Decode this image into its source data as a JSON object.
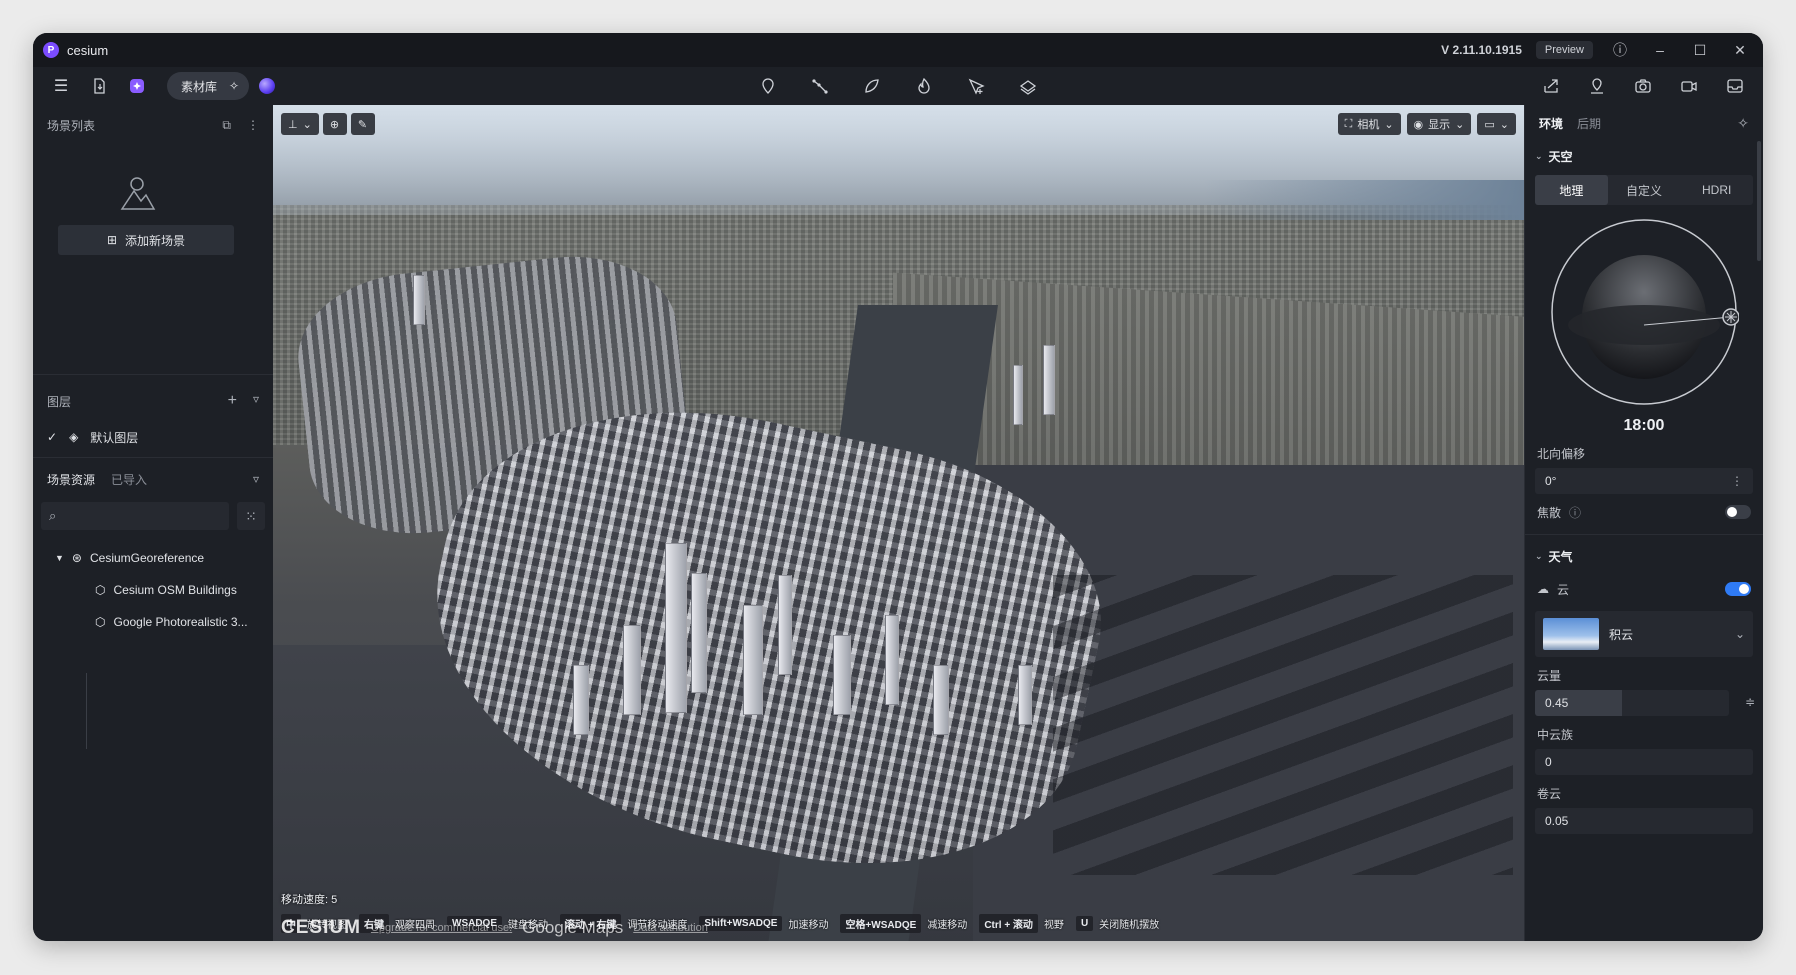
{
  "app": {
    "logo_letter": "P",
    "title": "cesium",
    "version": "V 2.11.10.1915",
    "preview": "Preview"
  },
  "toolbar": {
    "library": "素材库"
  },
  "scene_list": {
    "title": "场景列表",
    "add_scene": "添加新场景"
  },
  "layers": {
    "title": "图层",
    "items": [
      {
        "label": "默认图层",
        "checked": true
      }
    ]
  },
  "assets": {
    "tab_active": "场景资源",
    "tab_inactive": "已导入",
    "search_placeholder": "",
    "tree": [
      {
        "label": "CesiumGeoreference",
        "level": 0,
        "expanded": true
      },
      {
        "label": "Cesium OSM Buildings",
        "level": 1
      },
      {
        "label": "Google Photorealistic 3...",
        "level": 1
      }
    ]
  },
  "viewport": {
    "camera_btn": "相机",
    "display_btn": "显示",
    "speed": "移动速度: 5",
    "shortcuts": [
      {
        "key": "中",
        "desc": "旋转视图"
      },
      {
        "key": "右键",
        "desc": "观察四周"
      },
      {
        "key": "WSADQE",
        "desc": "键盘移动"
      },
      {
        "key": "滚动 + 右键",
        "desc": "调节移动速度"
      },
      {
        "key": "Shift+WSADQE",
        "desc": "加速移动"
      },
      {
        "key": "空格+WSADQE",
        "desc": "减速移动"
      },
      {
        "key": "Ctrl + 滚动",
        "desc": "视野"
      },
      {
        "key": "U",
        "desc": "关闭随机摆放"
      }
    ],
    "attribution": {
      "cesium": "CESIUM",
      "upgrade": "Upgrade for commercial use.",
      "google": "Google Maps",
      "data": "Data attribution"
    }
  },
  "right_panel": {
    "tabs": [
      "环境",
      "后期"
    ],
    "sky": {
      "title": "天空",
      "modes": [
        "地理",
        "自定义",
        "HDRI"
      ],
      "active_mode": "地理",
      "time": "18:00",
      "north_offset_label": "北向偏移",
      "north_offset_value": "0°",
      "focus_label": "焦散",
      "focus_enabled": false
    },
    "weather": {
      "title": "天气",
      "cloud_label": "云",
      "cloud_enabled": true,
      "cloud_type": "积云",
      "cloud_amount_label": "云量",
      "cloud_amount_value": "0.45",
      "cloud_amount": 0.45,
      "mid_cloud_label": "中云族",
      "mid_cloud_value": "0",
      "cirrus_label": "卷云",
      "cirrus_value": "0.05"
    }
  },
  "colors": {
    "accent": "#2f7bf5",
    "brand": "#7b4cff",
    "panel": "#1d2026"
  }
}
